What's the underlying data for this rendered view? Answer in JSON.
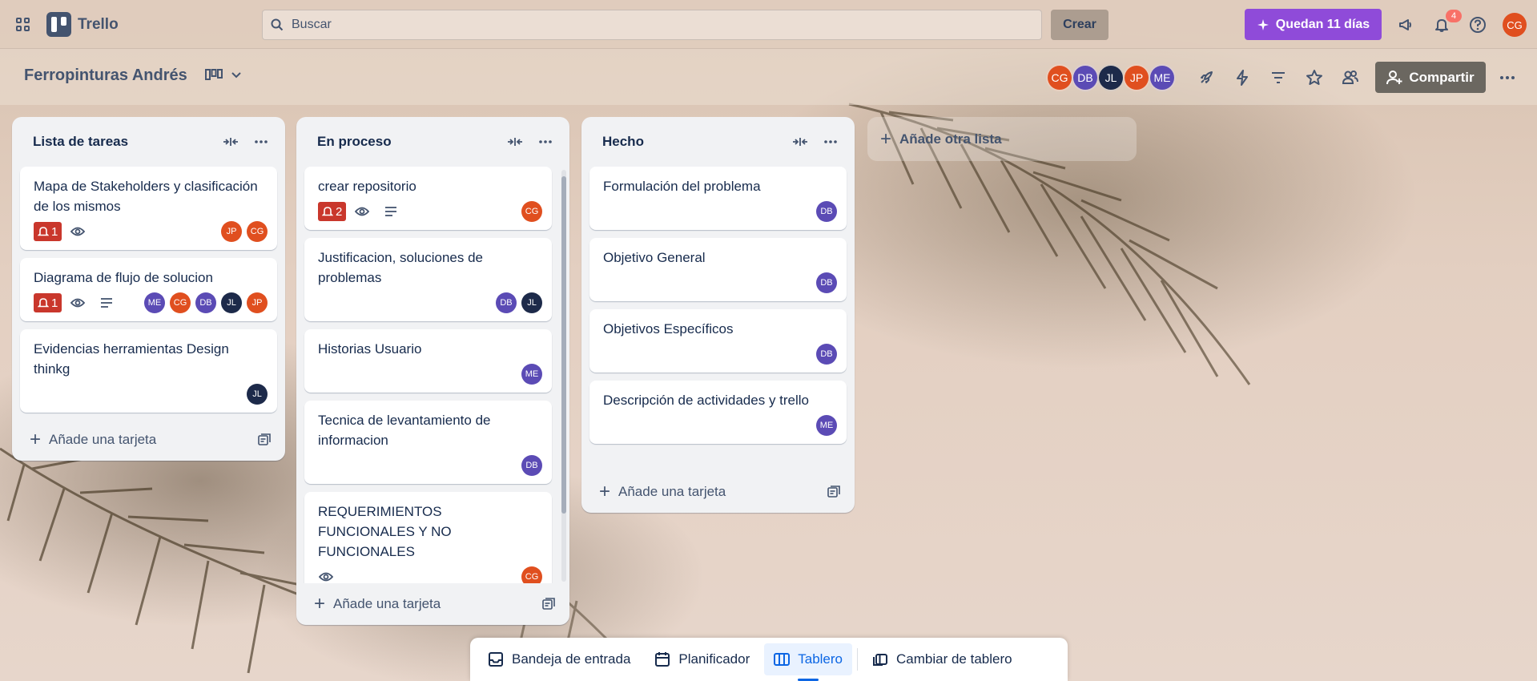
{
  "colors": {
    "CG": "#e04f1f",
    "DB": "#5b4bb5",
    "JL": "#1d2a4a",
    "JP": "#e04f1f",
    "ME": "#5b4bb5",
    "due_badge": "#c9372c",
    "trial": "#8f4bd9"
  },
  "topbar": {
    "app_name": "Trello",
    "search_placeholder": "Buscar",
    "create_label": "Crear",
    "trial_label": "Quedan 11 días",
    "notifications_count": "4",
    "user_initials": "CG"
  },
  "board": {
    "title": "Ferropinturas Andrés",
    "members": [
      "CG",
      "DB",
      "JL",
      "JP",
      "ME"
    ],
    "share_label": "Compartir",
    "add_list_label": "Añade otra lista"
  },
  "lists": [
    {
      "title": "Lista de tareas",
      "add_card_label": "Añade una tarjeta",
      "cards": [
        {
          "title": "Mapa de Stakeholders y clasificación de los mismos",
          "due": "1",
          "watch": true,
          "desc": false,
          "members": [
            "JP",
            "CG"
          ]
        },
        {
          "title": "Diagrama de flujo de solucion",
          "due": "1",
          "watch": true,
          "desc": true,
          "members": [
            "ME",
            "CG",
            "DB",
            "JL",
            "JP"
          ]
        },
        {
          "title": "Evidencias herramientas Design thinkg",
          "due": "",
          "watch": false,
          "desc": false,
          "members": [
            "JL"
          ]
        }
      ]
    },
    {
      "title": "En proceso",
      "add_card_label": "Añade una tarjeta",
      "cards": [
        {
          "title": "crear repositorio",
          "due": "2",
          "watch": true,
          "desc": true,
          "members": [
            "CG"
          ]
        },
        {
          "title": "Justificacion, soluciones de problemas",
          "due": "",
          "watch": false,
          "desc": false,
          "members": [
            "DB",
            "JL"
          ]
        },
        {
          "title": "Historias Usuario",
          "due": "",
          "watch": false,
          "desc": false,
          "members": [
            "ME"
          ]
        },
        {
          "title": "Tecnica de levantamiento de informacion",
          "due": "",
          "watch": false,
          "desc": false,
          "members": [
            "DB"
          ]
        },
        {
          "title": "REQUERIMIENTOS FUNCIONALES Y NO FUNCIONALES",
          "due": "",
          "watch": true,
          "desc": false,
          "members": [
            "CG"
          ]
        }
      ]
    },
    {
      "title": "Hecho",
      "add_card_label": "Añade una tarjeta",
      "cards": [
        {
          "title": "Formulación del problema",
          "due": "",
          "watch": false,
          "desc": false,
          "members": [
            "DB"
          ]
        },
        {
          "title": "Objetivo General",
          "due": "",
          "watch": false,
          "desc": false,
          "members": [
            "DB"
          ]
        },
        {
          "title": "Objetivos Específicos",
          "due": "",
          "watch": false,
          "desc": false,
          "members": [
            "DB"
          ]
        },
        {
          "title": "Descripción de actividades y trello",
          "due": "",
          "watch": false,
          "desc": false,
          "members": [
            "ME"
          ]
        }
      ]
    }
  ],
  "bottom_nav": {
    "inbox": "Bandeja de entrada",
    "planner": "Planificador",
    "board": "Tablero",
    "switch": "Cambiar de tablero"
  }
}
